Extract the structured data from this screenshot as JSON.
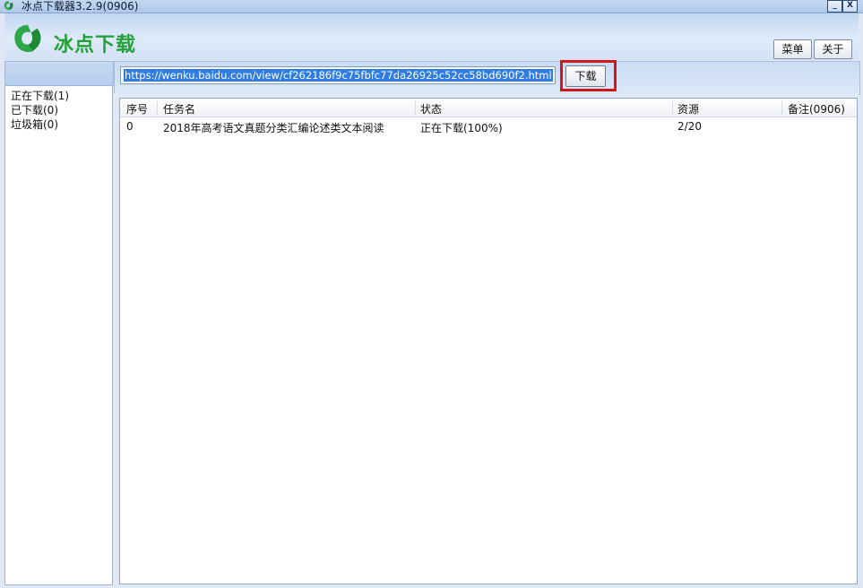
{
  "window": {
    "title": "冰点下载器3.2.9(0906)",
    "minimize_label": "_",
    "close_label": "X"
  },
  "header": {
    "brand": "冰点下载",
    "brand_color": "#22a13a",
    "menu_label": "菜单",
    "about_label": "关于"
  },
  "sidebar": {
    "items": [
      {
        "label": "正在下载(1)"
      },
      {
        "label": "已下载(0)"
      },
      {
        "label": "垃圾箱(0)"
      }
    ]
  },
  "toolbar": {
    "url_value": "https://wenku.baidu.com/view/cf262186f9c75fbfc77da26925c52cc58bd690f2.html",
    "download_label": "下载",
    "highlight_color": "#d2161d"
  },
  "table": {
    "columns": [
      "序号",
      "任务名",
      "状态",
      "资源",
      "备注(0906)"
    ],
    "rows": [
      {
        "index": "0",
        "name": "2018年高考语文真题分类汇编论述类文本阅读",
        "status": "正在下载(100%)",
        "resource": "2/20",
        "note": ""
      }
    ]
  }
}
